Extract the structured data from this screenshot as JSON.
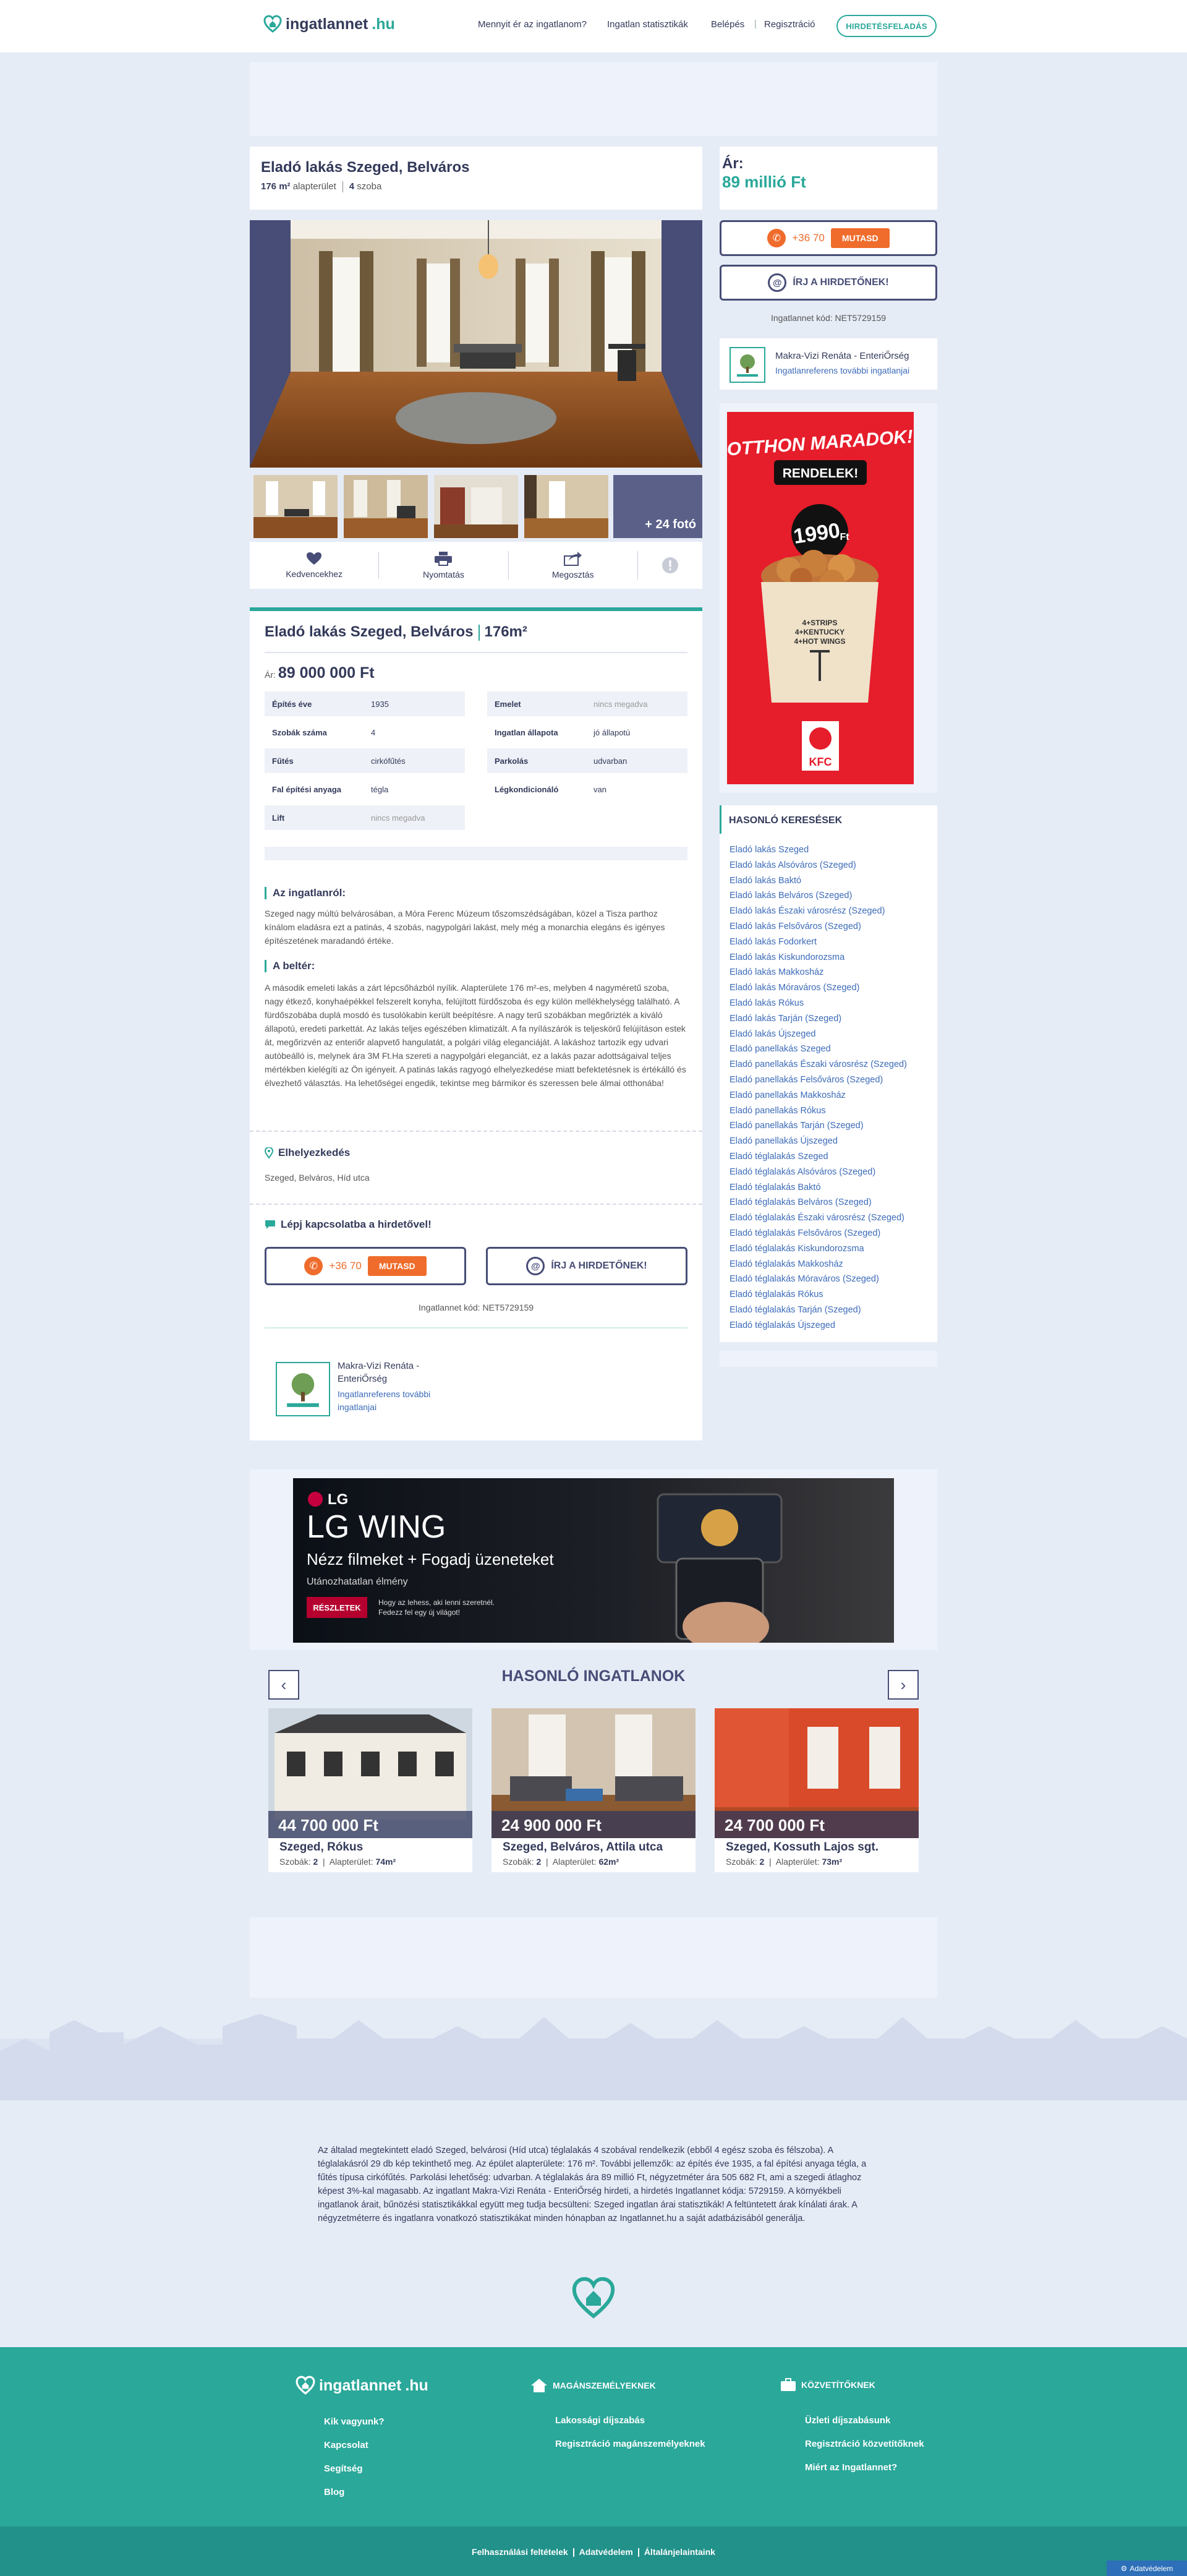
{
  "header": {
    "brand_name": "ingatlannet",
    "brand_tld": ".hu",
    "nav": [
      "Mennyit ér az ingatlanom?",
      "Ingatlan statisztikák",
      "Belépés",
      "|",
      "Regisztráció"
    ],
    "post_button": "HIRDETÉSFELADÁS"
  },
  "listing": {
    "title": "Eladó lakás Szeged, Belváros",
    "area_value": "176 m²",
    "area_label": "alapterület",
    "rooms_value": "4",
    "rooms_label": "szoba",
    "price_label": "Ár:",
    "price_value": "89 millió Ft",
    "more_photos": "+ 24 fotó"
  },
  "actions": [
    "Kedvencekhez",
    "Nyomtatás",
    "Megosztás"
  ],
  "contact": {
    "phone_prefix": "+36 70",
    "show_button": "MUTASD",
    "write_button": "ÍRJ A HIRDETŐNEK!",
    "code": "Ingatlannet kód: NET5729159",
    "agent_name": "Makra-Vizi Renáta - EnteriŐrség",
    "agent_link": "Ingatlanreferens további ingatlanjai",
    "agent_name_wrapped_1": "Makra-Vizi Renáta -",
    "agent_name_wrapped_2": "EnteriŐrség",
    "agent_link_wrapped_1": "Ingatlanreferens további",
    "agent_link_wrapped_2": "ingatlanjai",
    "heading": "Lépj kapcsolatba a hirdetővel!"
  },
  "kfc_ad": {
    "headline": "OTTHON MARADOK!",
    "cta": "RENDELEK!",
    "price": "1990",
    "price_suffix": "Ft",
    "bucket_lines": [
      "4+STRIPS",
      "4+KENTUCKY",
      "4+HOT WINGS"
    ],
    "brand": "KFC"
  },
  "similar_searches": {
    "title": "HASONLÓ KERESÉSEK",
    "items": [
      "Eladó lakás Szeged",
      "Eladó lakás Alsóváros (Szeged)",
      "Eladó lakás Baktó",
      "Eladó lakás Belváros (Szeged)",
      "Eladó lakás Északi városrész (Szeged)",
      "Eladó lakás Felsőváros (Szeged)",
      "Eladó lakás Fodorkert",
      "Eladó lakás Kiskundorozsma",
      "Eladó lakás Makkosház",
      "Eladó lakás Móraváros (Szeged)",
      "Eladó lakás Rókus",
      "Eladó lakás Tarján (Szeged)",
      "Eladó lakás Újszeged",
      "Eladó panellakás Szeged",
      "Eladó panellakás Északi városrész (Szeged)",
      "Eladó panellakás Felsőváros (Szeged)",
      "Eladó panellakás Makkosház",
      "Eladó panellakás Rókus",
      "Eladó panellakás Tarján (Szeged)",
      "Eladó panellakás Újszeged",
      "Eladó téglalakás Szeged",
      "Eladó téglalakás Alsóváros (Szeged)",
      "Eladó téglalakás Baktó",
      "Eladó téglalakás Belváros (Szeged)",
      "Eladó téglalakás Északi városrész (Szeged)",
      "Eladó téglalakás Felsőváros (Szeged)",
      "Eladó téglalakás Kiskundorozsma",
      "Eladó téglalakás Makkosház",
      "Eladó téglalakás Móraváros (Szeged)",
      "Eladó téglalakás Rókus",
      "Eladó téglalakás Tarján (Szeged)",
      "Eladó téglalakás Újszeged"
    ]
  },
  "details": {
    "title": "Eladó lakás Szeged, Belváros",
    "area": "176m²",
    "price_label": "Ár:",
    "price_value": "89 000 000 Ft",
    "left_props": [
      {
        "k": "Építés éve",
        "v": "1935"
      },
      {
        "k": "Szobák száma",
        "v": "4"
      },
      {
        "k": "Fűtés",
        "v": "cirkófűtés"
      },
      {
        "k": "Fal építési anyaga",
        "v": "tégla"
      },
      {
        "k": "Lift",
        "v": "nincs megadva"
      }
    ],
    "right_props": [
      {
        "k": "Emelet",
        "v": "nincs megadva"
      },
      {
        "k": "Ingatlan állapota",
        "v": "jó állapotú"
      },
      {
        "k": "Parkolás",
        "v": "udvarban"
      },
      {
        "k": "Légkondicionáló",
        "v": "van"
      }
    ],
    "about_title": "Az ingatlanról:",
    "about_text": "Szeged nagy múltú belvárosában, a Móra Ferenc Múzeum tőszomszédságában, közel a Tisza parthoz kínálom eladásra ezt a patinás, 4 szobás, nagypolgári lakást, mely még a monarchia elegáns és igényes építészetének maradandó értéke.",
    "interior_title": "A beltér:",
    "interior_text": "A második emeleti lakás a zárt lépcsőházból nyílik. Alapterülete 176 m²-es, melyben 4 nagyméretű szoba, nagy étkező, konyhaépékkel felszerelt konyha, felújított fürdőszoba és egy külön mellékhelységg található. A fürdőszobába duplá mosdó és tusolókabin került beépítésre. A nagy terű szobákban megőrizték a kiváló állapotú, eredeti parkettát. Az lakás teljes egészében klimatizált. A fa nyílászárók is teljeskörű felújításon estek át, megőrizvén az enteriőr alapvető hangulatát, a polgári világ eleganciáját. A lakáshoz tartozik egy udvari autóbeálló is, melynek ára 3M Ft.Ha szereti a nagypolgári eleganciát, ez a lakás pazar adottságaival teljes mértékben kielégíti az Ön igényeit. A patinás lakás ragyogó elhelyezkedése miatt befektetésnek is értékálló és élvezhető választás. Ha lehetőségei engedik, tekintse meg bármikor és szeressen bele álmai otthonába!",
    "location_title": "Elhelyezkedés",
    "location_text": "Szeged, Belváros, Híd utca"
  },
  "lg_ad": {
    "brand": "LG",
    "product": "LG WING",
    "headline": "Nézz filmeket + Fogadj üzeneteket",
    "sub": "Utánozhatatlan élmény",
    "cta": "RÉSZLETEK",
    "note_1": "Hogy az lehess, aki lenni szeretnél.",
    "note_2": "Fedezz fel egy új világot!"
  },
  "similar_listings": {
    "title": "HASONLÓ INGATLANOK",
    "cards": [
      {
        "price": "44 700 000 Ft",
        "address": "Szeged, Rókus",
        "rooms_label": "Szobák:",
        "rooms": "2",
        "area_label": "Alapterület:",
        "area": "74m²"
      },
      {
        "price": "24 900 000 Ft",
        "address": "Szeged, Belváros, Attila utca",
        "rooms_label": "Szobák:",
        "rooms": "2",
        "area_label": "Alapterület:",
        "area": "62m²"
      },
      {
        "price": "24 700 000 Ft",
        "address": "Szeged, Kossuth Lajos sgt.",
        "rooms_label": "Szobák:",
        "rooms": "2",
        "area_label": "Alapterület:",
        "area": "73m²"
      }
    ]
  },
  "footer": {
    "seo_text": "Az általad megtekintett eladó Szeged, belvárosi (Híd utca) téglalakás 4 szobával rendelkezik (ebből 4 egész szoba és félszoba). A téglalakásról 29 db kép tekinthető meg. Az épület alapterülete: 176 m². További jellemzők: az építés éve 1935, a fal építési anyaga tégla, a fűtés típusa cirkófűtés. Parkolási lehetőség: udvarban. A téglalakás ára 89 millió Ft, négyzetméter ára 505 682 Ft, ami a szegedi átlaghoz képest 3%-kal magasabb. Az ingatlant Makra-Vizi Renáta - EnteriŐrség hirdeti, a hirdetés Ingatlannet kódja: 5729159. A környékbeli ingatlanok árait, bűnözési statisztikákkal együtt meg tudja becsülteni: Szeged ingatlan árai statisztikák! A feltüntetett árak kínálati árak. A négyzetméterre és ingatlanra vonatkozó statisztikákat minden hónapban az Ingatlannet.hu a saját adatbázisából generálja.",
    "col1_links": [
      "Kik vagyunk?",
      "Kapcsolat",
      "Segítség",
      "Blog"
    ],
    "col2_title": "MAGÁNSZEMÉLYEKNEK",
    "col2_links": [
      "Lakossági díjszabás",
      "Regisztráció magánszemélyeknek"
    ],
    "col3_title": "KÖZVETÍTŐKNEK",
    "col3_links": [
      "Üzleti díjszabásunk",
      "Regisztráció közvetítőknek",
      "Miért az Ingatlannet?"
    ],
    "bottom_links": [
      "Felhasználási feltételek",
      "Adatvédelem",
      "Általánjelaintaink"
    ],
    "privacy_badge": "Adatvédelem"
  },
  "colors": {
    "accent": "#2aa89a",
    "navy": "#474d76",
    "orange": "#ef6c2c",
    "link": "#3c6bb9",
    "bg": "#e6ecf6"
  }
}
